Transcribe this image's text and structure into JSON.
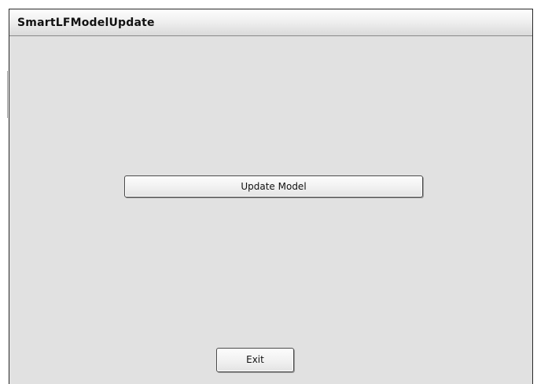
{
  "window": {
    "title": "SmartLFModelUpdate"
  },
  "buttons": {
    "update_model": "Update Model",
    "exit": "Exit"
  }
}
